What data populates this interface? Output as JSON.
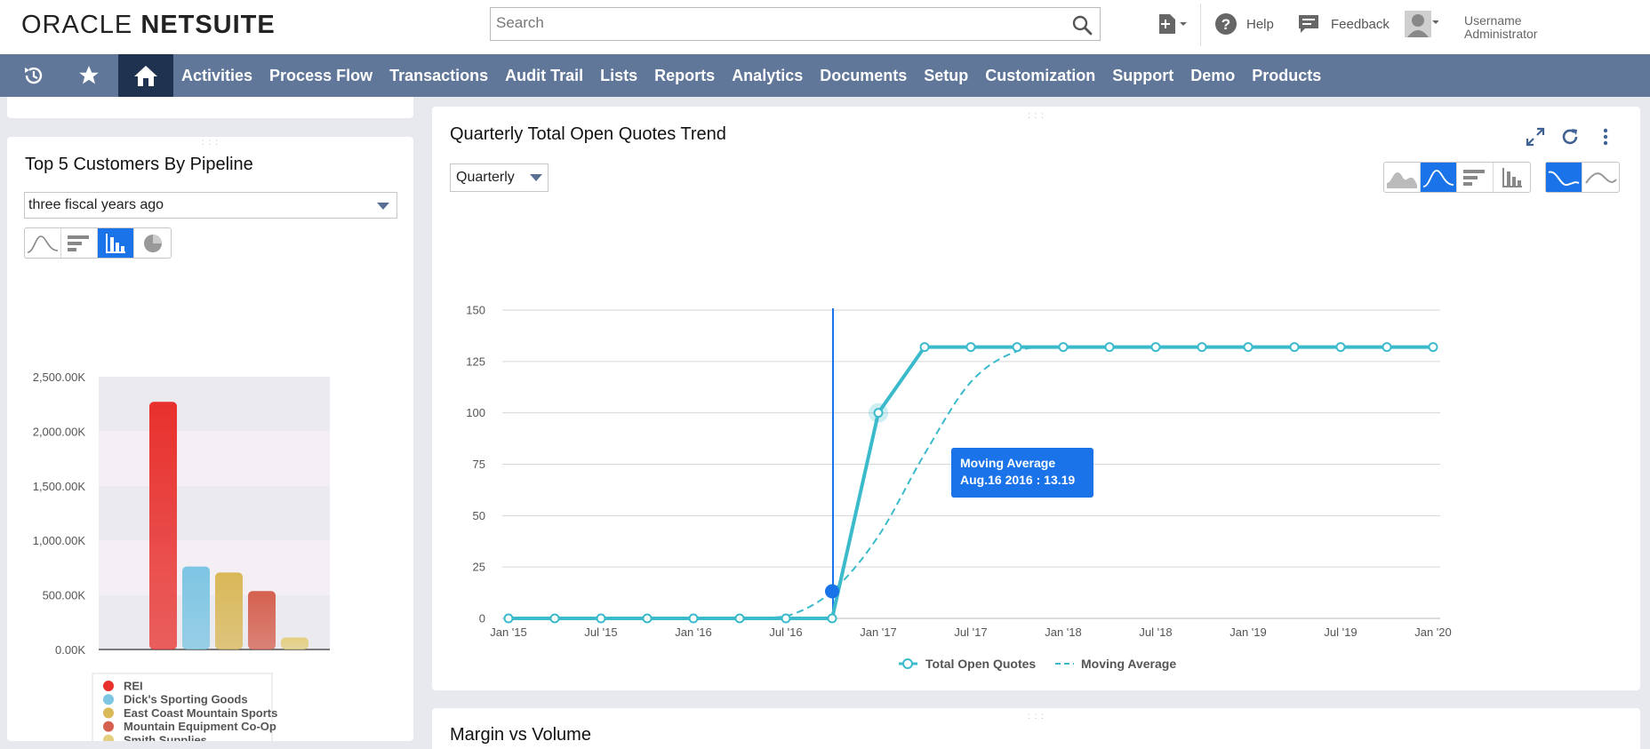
{
  "header": {
    "logo_light": "ORACLE ",
    "logo_bold": "NETSUITE",
    "search_placeholder": "Search",
    "help_label": "Help",
    "feedback_label": "Feedback",
    "user_name": "Username",
    "user_role": "Administrator"
  },
  "nav": {
    "items": [
      "Activities",
      "Process Flow",
      "Transactions",
      "Audit Trail",
      "Lists",
      "Reports",
      "Analytics",
      "Documents",
      "Setup",
      "Customization",
      "Support",
      "Demo",
      "Products"
    ]
  },
  "left_portlet": {
    "title": "Top 5 Customers By Pipeline",
    "period_value": "three fiscal years ago"
  },
  "main_portlet": {
    "title": "Quarterly Total Open Quotes Trend",
    "period_value": "Quarterly",
    "tooltip_title": "Moving Average",
    "tooltip_value": "Aug.16 2016 : 13.19"
  },
  "bottom_portlet": {
    "title": "Margin vs Volume"
  },
  "colors": {
    "nav_bg": "#607799",
    "nav_active": "#1f3350",
    "accent": "#1a73e8",
    "series_line": "#3bbacb"
  },
  "chart_data": [
    {
      "type": "bar",
      "title": "Top 5 Customers By Pipeline",
      "categories": [
        "REI",
        "Dick's Sporting Goods",
        "East Coast Mountain Sports",
        "Mountain Equipment Co-Op",
        "Smith Supplies"
      ],
      "values": [
        2270,
        760,
        705,
        535,
        110
      ],
      "colors": [
        "#e8302c",
        "#7cc5e3",
        "#d9b857",
        "#d5604f",
        "#e3cf7f"
      ],
      "yticks": [
        "0.00K",
        "500.00K",
        "1,000.00K",
        "1,500.00K",
        "2,000.00K",
        "2,500.00K"
      ],
      "ylim": [
        0,
        2500
      ],
      "legend": "bottom"
    },
    {
      "type": "line",
      "title": "Quarterly Total Open Quotes Trend",
      "xticks": [
        "Jan '15",
        "Jul '15",
        "Jan '16",
        "Jul '16",
        "Jan '17",
        "Jul '17",
        "Jan '18",
        "Jul '18",
        "Jan '19",
        "Jul '19",
        "Jan '20"
      ],
      "yticks": [
        0,
        25,
        50,
        75,
        100,
        125,
        150
      ],
      "ylim": [
        0,
        150
      ],
      "series": [
        {
          "name": "Total Open Quotes",
          "values": [
            0,
            0,
            0,
            0,
            0,
            0,
            0,
            0,
            100,
            132,
            132,
            132,
            132,
            132,
            132,
            132,
            132,
            132,
            132,
            132,
            132
          ]
        },
        {
          "name": "Moving Average",
          "values": [
            0,
            0,
            0,
            0,
            0,
            0,
            1,
            13.19,
            40,
            80,
            115,
            130,
            132,
            132,
            132,
            132,
            132,
            132,
            132,
            132,
            132
          ]
        }
      ],
      "highlight_index": 7,
      "legend": "bottom"
    }
  ]
}
